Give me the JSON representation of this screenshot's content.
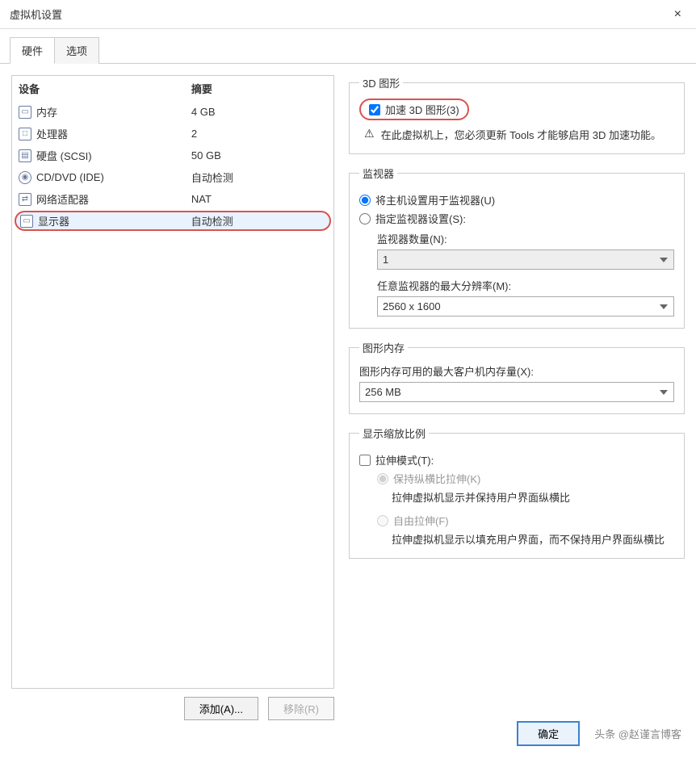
{
  "window": {
    "title": "虚拟机设置"
  },
  "tabs": {
    "hardware": "硬件",
    "options": "选项"
  },
  "hw": {
    "head_device": "设备",
    "head_summary": "摘要",
    "rows": [
      {
        "icon": "ram-icon",
        "name": "内存",
        "summary": "4 GB"
      },
      {
        "icon": "cpu-icon",
        "name": "处理器",
        "summary": "2"
      },
      {
        "icon": "hdd-icon",
        "name": "硬盘 (SCSI)",
        "summary": "50 GB"
      },
      {
        "icon": "disc-icon",
        "name": "CD/DVD (IDE)",
        "summary": "自动检测"
      },
      {
        "icon": "net-icon",
        "name": "网络适配器",
        "summary": "NAT"
      },
      {
        "icon": "display-icon",
        "name": "显示器",
        "summary": "自动检测"
      }
    ],
    "add_btn": "添加(A)...",
    "remove_btn": "移除(R)"
  },
  "gfx3d": {
    "legend": "3D 图形",
    "accel_label": "加速 3D 图形(3)",
    "warn_text": "在此虚拟机上，您必须更新 Tools 才能够启用 3D 加速功能。"
  },
  "monitors": {
    "legend": "监视器",
    "use_host": "将主机设置用于监视器(U)",
    "specify": "指定监视器设置(S):",
    "count_label": "监视器数量(N):",
    "count_value": "1",
    "maxres_label": "任意监视器的最大分辨率(M):",
    "maxres_value": "2560 x 1600"
  },
  "vram": {
    "legend": "图形内存",
    "label": "图形内存可用的最大客户机内存量(X):",
    "value": "256 MB"
  },
  "scale": {
    "legend": "显示缩放比例",
    "stretch_label": "拉伸模式(T):",
    "keep_ratio": "保持纵横比拉伸(K)",
    "keep_ratio_desc": "拉伸虚拟机显示并保持用户界面纵横比",
    "free": "自由拉伸(F)",
    "free_desc": "拉伸虚拟机显示以填充用户界面，而不保持用户界面纵横比"
  },
  "dlg": {
    "ok": "确定"
  },
  "watermark": "头条 @赵谨言博客"
}
